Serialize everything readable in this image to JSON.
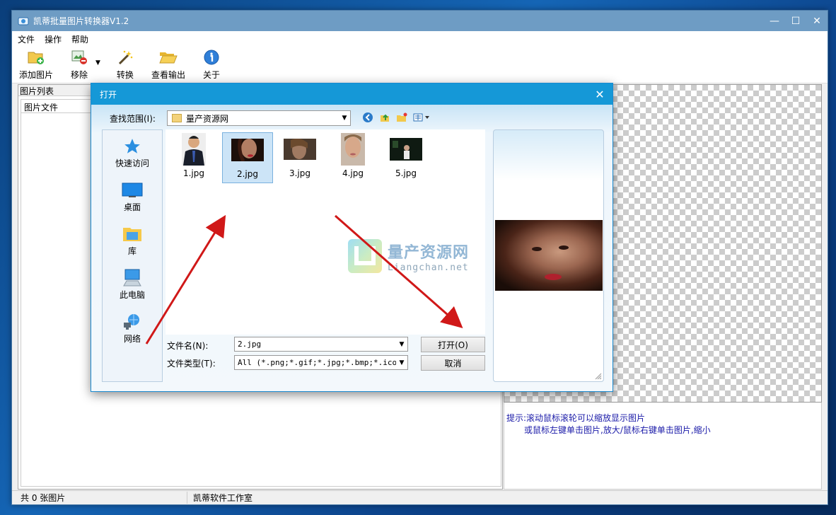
{
  "main_window": {
    "title": "凯蒂批量图片转换器V1.2",
    "menu": [
      "文件",
      "操作",
      "帮助"
    ],
    "toolbar": {
      "add_label": "添加图片",
      "remove_label": "移除",
      "convert_label": "转换",
      "view_output_label": "查看输出",
      "about_label": "关于"
    },
    "left_panel_title": "图片列表",
    "list_header": "图片文件",
    "hint_line1": "提示:滚动鼠标滚轮可以缩放显示图片",
    "hint_line2": "或鼠标左键单击图片,放大/鼠标右键单击图片,缩小",
    "status_count": "共 0 张图片",
    "status_company": "凯蒂软件工作室"
  },
  "dialog": {
    "title": "打开",
    "look_in_label": "查找范围(I):",
    "look_in_value": "量产资源网",
    "places": [
      "快速访问",
      "桌面",
      "库",
      "此电脑",
      "网络"
    ],
    "files": [
      "1.jpg",
      "2.jpg",
      "3.jpg",
      "4.jpg",
      "5.jpg"
    ],
    "selected_file": "2.jpg",
    "filename_label": "文件名(N):",
    "filename_value": "2.jpg",
    "filetype_label": "文件类型(T):",
    "filetype_value": "All (*.png;*.gif;*.jpg;*.bmp;*.ico;*.",
    "open_button": "打开(O)",
    "cancel_button": "取消"
  },
  "watermark": {
    "cn": "量产资源网",
    "en": "Liangchan.net"
  },
  "colors": {
    "dialog_title_bg": "#1598d7",
    "main_title_bg": "#6e9cc4",
    "hint_text": "#1a1aa8",
    "arrow": "#d01818"
  }
}
